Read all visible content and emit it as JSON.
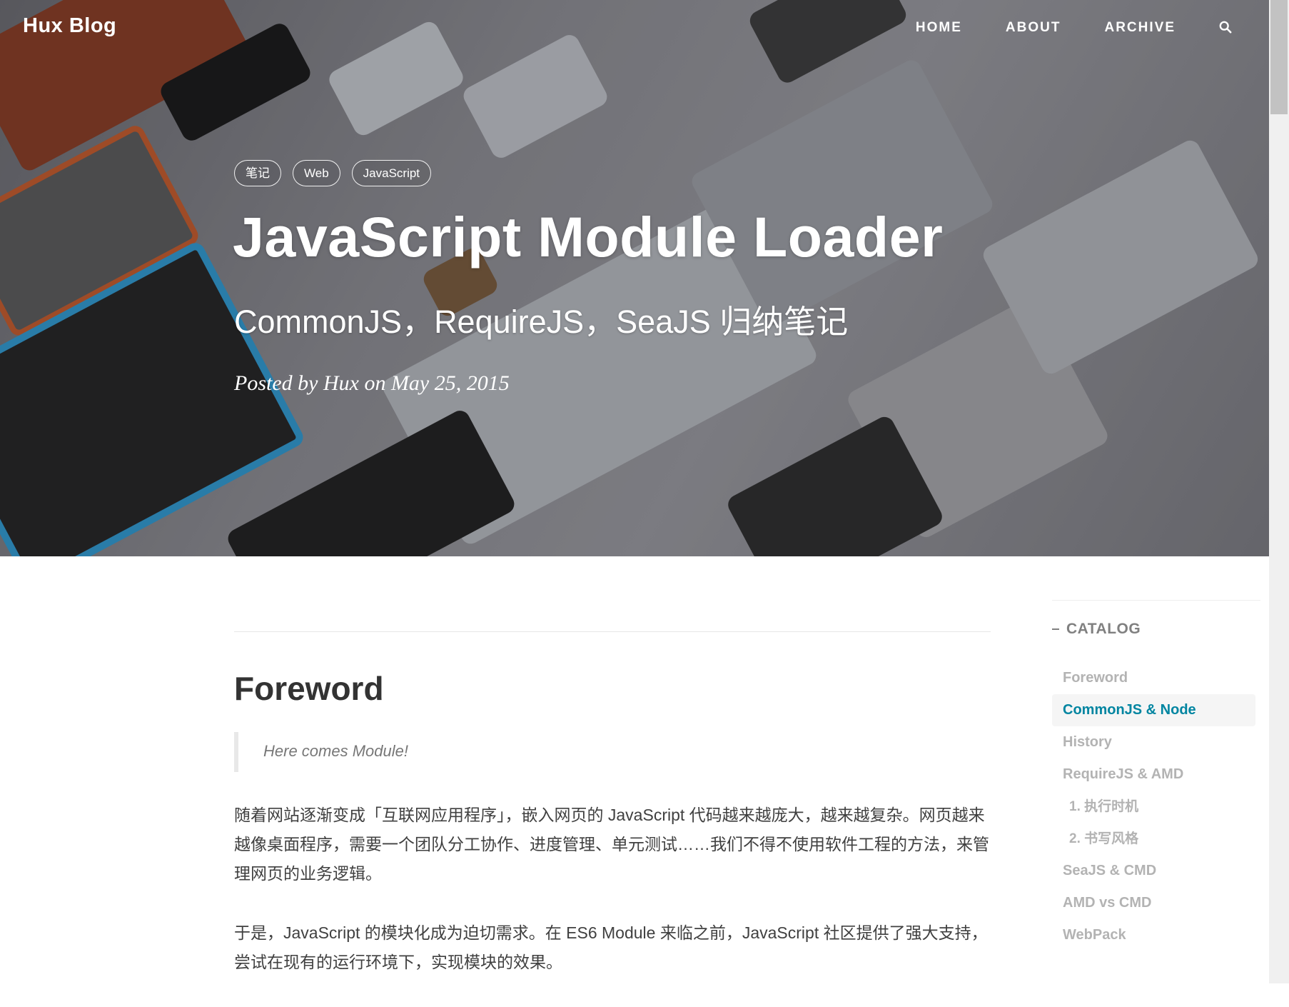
{
  "header": {
    "brand": "Hux Blog",
    "nav": [
      "HOME",
      "ABOUT",
      "ARCHIVE"
    ],
    "search_icon": "search-icon"
  },
  "post": {
    "tags": [
      "笔记",
      "Web",
      "JavaScript"
    ],
    "title": "JavaScript Module Loader",
    "subtitle": "CommonJS，RequireJS，SeaJS 归纳笔记",
    "meta": "Posted by Hux on May 25, 2015"
  },
  "content": {
    "section_heading": "Foreword",
    "quote": "Here comes Module!",
    "paragraphs": [
      "随着网站逐渐变成「互联网应用程序」，嵌入网页的 JavaScript 代码越来越庞大，越来越复杂。网页越来越像桌面程序，需要一个团队分工协作、进度管理、单元测试……我们不得不使用软件工程的方法，来管理网页的业务逻辑。",
      "于是，JavaScript 的模块化成为迫切需求。在 ES6 Module 来临之前，JavaScript 社区提供了强大支持，尝试在现有的运行环境下，实现模块的效果。"
    ]
  },
  "catalog": {
    "title": "CATALOG",
    "items": [
      "Foreword",
      "CommonJS & Node",
      "History",
      "RequireJS & AMD",
      "1. 执行时机",
      "2. 书写风格",
      "SeaJS & CMD",
      "AMD vs CMD",
      "WebPack"
    ],
    "active": "CommonJS & Node"
  },
  "colors": {
    "accent": "#0085a1",
    "catalog_text": "#b3b3b3",
    "body_text": "#404040"
  }
}
